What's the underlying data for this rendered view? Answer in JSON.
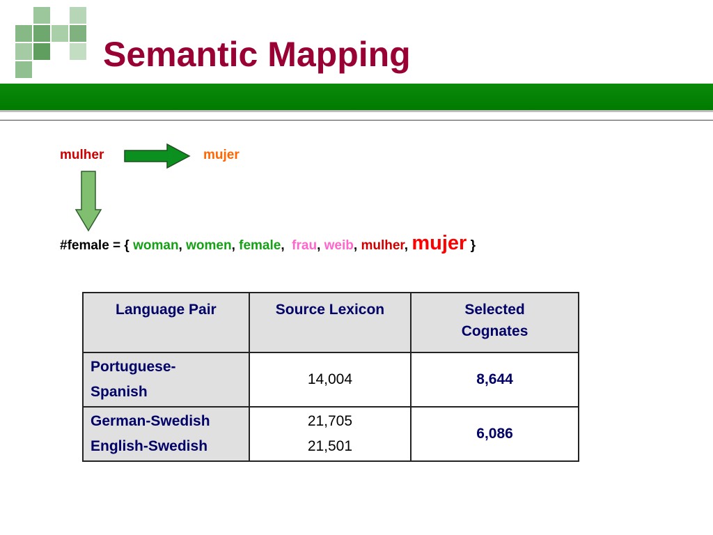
{
  "slide": {
    "title": "Semantic Mapping"
  },
  "diagram": {
    "source_word": "mulher",
    "target_word": "mujer"
  },
  "set": {
    "prefix": "#female = { ",
    "green_words": [
      "woman",
      "women",
      "female"
    ],
    "pink_words": [
      "frau",
      "weib"
    ],
    "red_word": "mulher",
    "big_word": "mujer",
    "suffix": " }"
  },
  "table": {
    "headers": [
      "Language Pair",
      "Source Lexicon",
      "Selected Cognates"
    ],
    "rows": [
      {
        "pairs": [
          "Portuguese-",
          "Spanish"
        ],
        "lexicon": [
          "14,004"
        ],
        "selected": "8,644"
      },
      {
        "pairs": [
          "German-Swedish",
          "English-Swedish"
        ],
        "lexicon": [
          "21,705",
          "21,501"
        ],
        "selected": "6,086"
      }
    ]
  },
  "colors": {
    "title": "#990033",
    "bar": "#007b00",
    "green_word": "#16a016",
    "pink_word": "#ff66cc",
    "red_word": "#cc0000",
    "orange_word": "#ff6600",
    "header_text": "#000066"
  }
}
